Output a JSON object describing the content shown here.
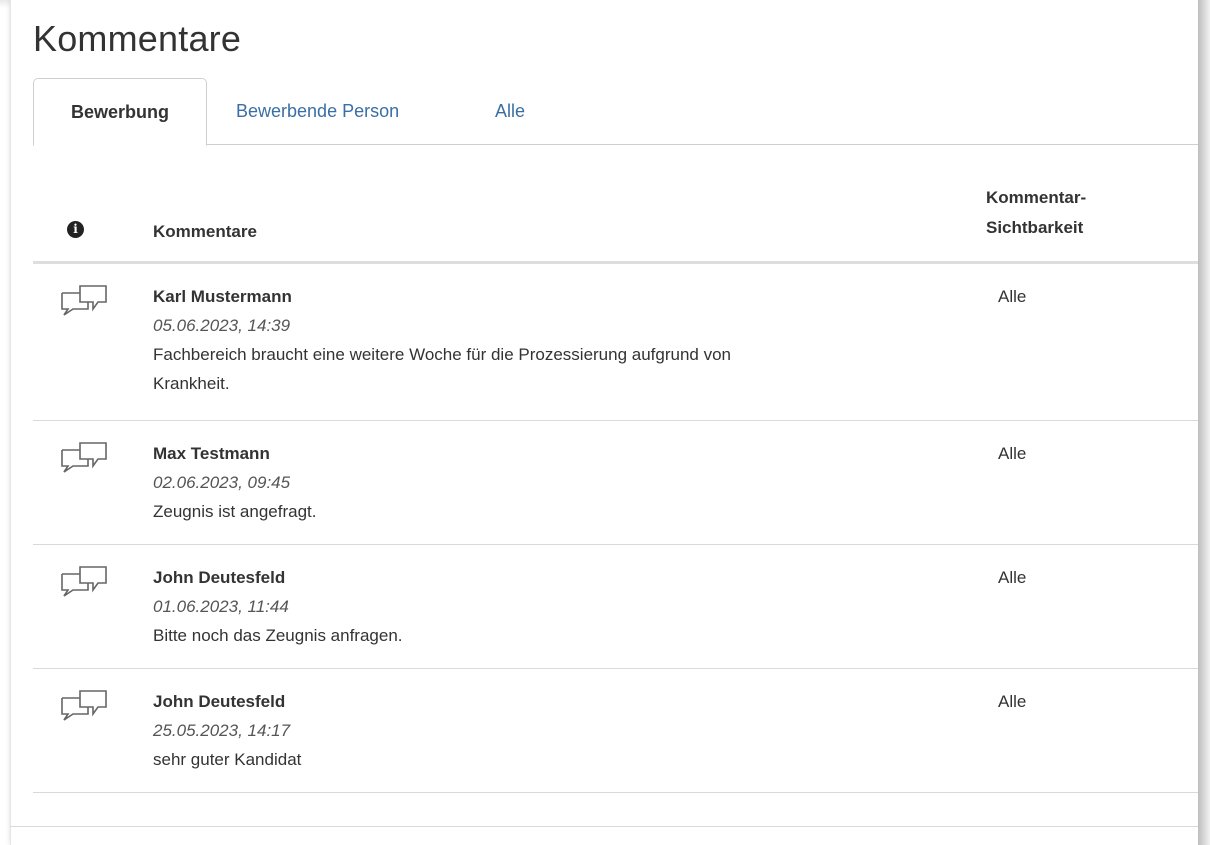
{
  "page": {
    "title": "Kommentare"
  },
  "tabs": [
    {
      "label": "Bewerbung",
      "active": true
    },
    {
      "label": "Bewerbende Person",
      "active": false
    },
    {
      "label": "Alle",
      "active": false
    }
  ],
  "table": {
    "header_info_icon": "info-circle-icon",
    "col_comments": "Kommentare",
    "col_visibility_line1": "Kommentar-",
    "col_visibility_line2": "Sichtbarkeit"
  },
  "rows": [
    {
      "icon": "comments-icon",
      "author": "Karl Mustermann",
      "date": "05.06.2023, 14:39",
      "text_line1": "Fachbereich braucht eine weitere Woche für die Prozessierung aufgrund von",
      "text_line2": "Krankheit.",
      "visibility": "Alle"
    },
    {
      "icon": "comments-icon",
      "author": "Max Testmann",
      "date": "02.06.2023, 09:45",
      "text_line1": "Zeugnis ist angefragt.",
      "visibility": "Alle"
    },
    {
      "icon": "comments-icon",
      "author": "John Deutesfeld",
      "date": "01.06.2023, 11:44",
      "text_line1": "Bitte noch das Zeugnis anfragen.",
      "visibility": "Alle"
    },
    {
      "icon": "comments-icon",
      "author": "John Deutesfeld",
      "date": "25.05.2023, 14:17",
      "text_line1": "sehr guter Kandidat",
      "visibility": "Alle"
    }
  ],
  "colors": {
    "link": "#3a6ea5",
    "text": "#333333",
    "border": "#d9d9d9"
  }
}
